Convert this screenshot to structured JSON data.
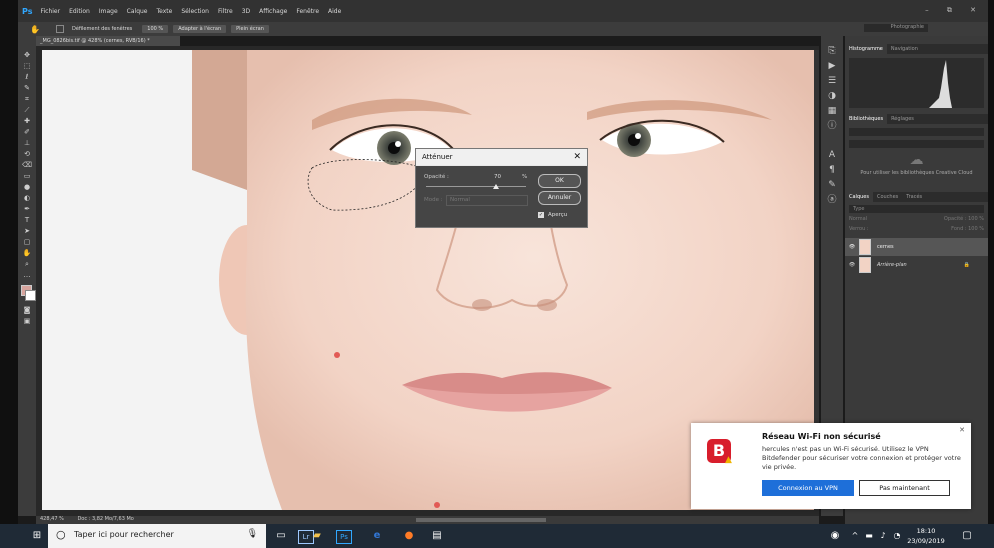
{
  "app": {
    "logo": "Ps",
    "menu": [
      "Fichier",
      "Edition",
      "Image",
      "Calque",
      "Texte",
      "Sélection",
      "Filtre",
      "3D",
      "Affichage",
      "Fenêtre",
      "Aide"
    ],
    "window_controls": "–  ⧉  ✕"
  },
  "options_bar": {
    "scroll_all_windows": "Défilement des fenêtres",
    "zoom": "100 %",
    "fit_screen": "Adapter à l'écran",
    "fill_screen": "Plein écran",
    "workspace": "Photographie"
  },
  "document": {
    "tab_title": "_MG_0826bis.tif @ 428% (cernes, RVB/16) *",
    "zoom_status": "428,47 %",
    "doc_status": "Doc : 3,82 Mo/7,63 Mo"
  },
  "panels": {
    "tabs_top": [
      "Histogramme",
      "Navigation"
    ],
    "tabs_lib": [
      "Bibliothèques",
      "Réglages"
    ],
    "lib_message": "Pour utiliser les bibliothèques Creative Cloud",
    "tabs_layers": [
      "Calques",
      "Couches",
      "Tracés"
    ],
    "filter_placeholder": "Type",
    "blend_mode": "Normal",
    "opacity_label": "Opacité :",
    "opacity_value": "100 %",
    "lock_label": "Verrou :",
    "fill_label": "Fond :",
    "fill_value": "100 %",
    "layers": [
      {
        "name": "cernes",
        "italic": false,
        "active": true
      },
      {
        "name": "Arrière-plan",
        "italic": true,
        "active": false
      }
    ]
  },
  "dialog": {
    "title": "Atténuer",
    "opacity_label": "Opacité :",
    "opacity_value": "70",
    "opacity_fraction": 0.7,
    "percent": "%",
    "mode_label": "Mode :",
    "mode_value": "Normal",
    "ok": "OK",
    "cancel": "Annuler",
    "preview": "Aperçu"
  },
  "notification": {
    "title": "Réseau Wi-Fi non sécurisé",
    "body": "hercules n'est pas un Wi-Fi sécurisé. Utilisez le VPN Bitdefender pour sécuriser votre connexion et protéger votre vie privée.",
    "primary": "Connexion au VPN",
    "secondary": "Pas maintenant",
    "logo_letter": "B",
    "brand_color": "#d81e2c"
  },
  "taskbar": {
    "search_placeholder": "Taper ici pour rechercher",
    "time": "18:10",
    "date": "23/09/2019",
    "pinned": [
      "Lr",
      "Ps"
    ]
  }
}
